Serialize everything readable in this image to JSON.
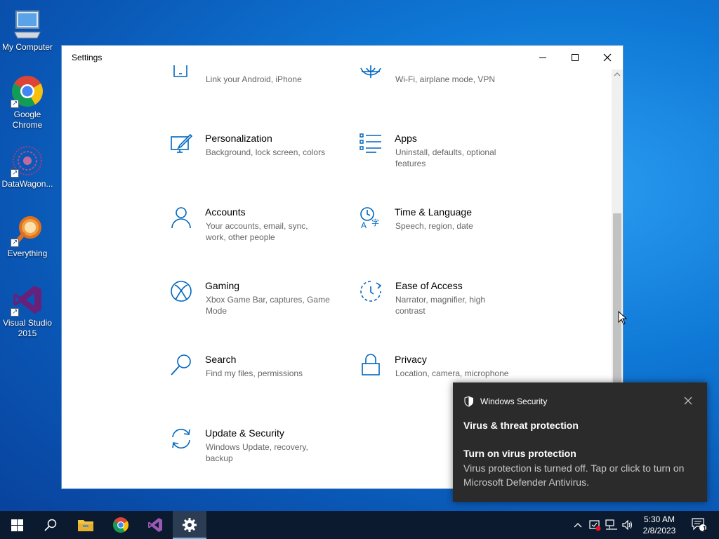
{
  "desktop": {
    "icons": [
      {
        "label": "My Computer"
      },
      {
        "label": "Google Chrome"
      },
      {
        "label": "DataWagon..."
      },
      {
        "label": "Everything"
      },
      {
        "label": "Visual Studio 2015"
      }
    ]
  },
  "window": {
    "title": "Settings",
    "tiles": [
      {
        "name": "",
        "desc": "Link your Android, iPhone",
        "icon": "phone-icon"
      },
      {
        "name": "",
        "desc": "Wi-Fi, airplane mode, VPN",
        "icon": "globe-icon"
      },
      {
        "name": "Personalization",
        "desc": "Background, lock screen, colors",
        "icon": "personalization-icon"
      },
      {
        "name": "Apps",
        "desc": "Uninstall, defaults, optional features",
        "icon": "apps-icon"
      },
      {
        "name": "Accounts",
        "desc": "Your accounts, email, sync, work, other people",
        "icon": "person-icon"
      },
      {
        "name": "Time & Language",
        "desc": "Speech, region, date",
        "icon": "time-language-icon"
      },
      {
        "name": "Gaming",
        "desc": "Xbox Game Bar, captures, Game Mode",
        "icon": "xbox-icon"
      },
      {
        "name": "Ease of Access",
        "desc": "Narrator, magnifier, high contrast",
        "icon": "ease-of-access-icon"
      },
      {
        "name": "Search",
        "desc": "Find my files, permissions",
        "icon": "search-icon"
      },
      {
        "name": "Privacy",
        "desc": "Location, camera, microphone",
        "icon": "lock-icon"
      },
      {
        "name": "Update & Security",
        "desc": "Windows Update, recovery, backup",
        "icon": "update-icon"
      }
    ]
  },
  "toast": {
    "app": "Windows Security",
    "heading": "Virus & threat protection",
    "subheading": "Turn on virus protection",
    "body": "Virus protection is turned off. Tap or click to turn on Microsoft Defender Antivirus."
  },
  "taskbar": {
    "time": "5:30 AM",
    "date": "2/8/2023",
    "notification_count": "1"
  },
  "colors": {
    "accent": "#0067c0",
    "desktop": "#0f78d6",
    "taskbar": "#0b1a2e"
  }
}
